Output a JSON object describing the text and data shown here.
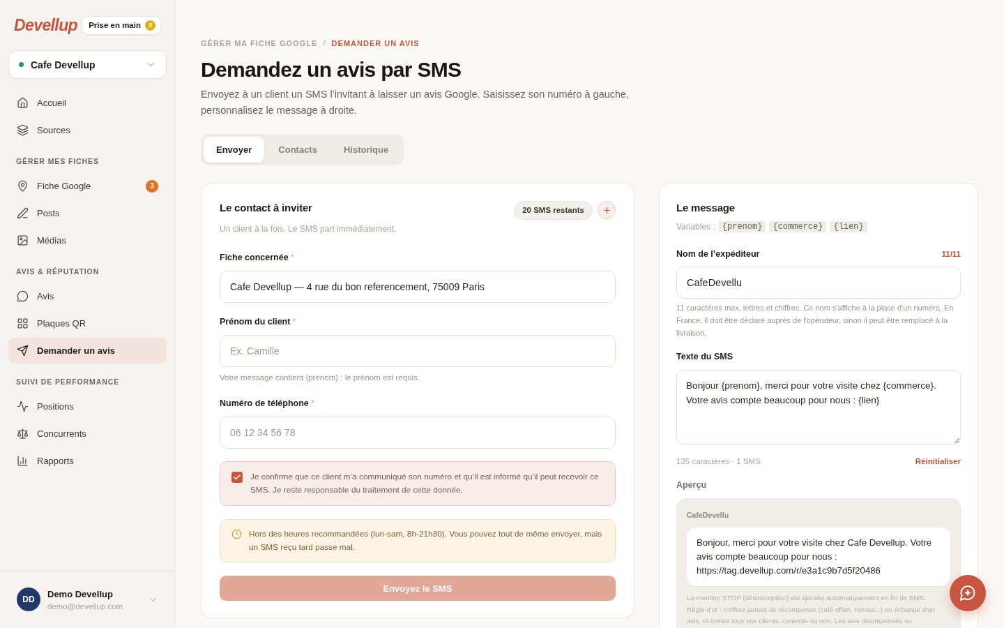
{
  "sidebar": {
    "logo": "Devellup",
    "onboarding": {
      "label": "Prise en main",
      "badge": "3"
    },
    "business": {
      "name": "Cafe Devellup"
    },
    "nav_groups": [
      {
        "items": [
          {
            "label": "Accueil",
            "selected": false
          },
          {
            "label": "Sources",
            "selected": false
          }
        ]
      },
      {
        "heading": "GÉRER MES FICHES",
        "items": [
          {
            "label": "Fiche Google",
            "selected": false,
            "badge": "3"
          },
          {
            "label": "Posts",
            "selected": false
          },
          {
            "label": "Médias",
            "selected": false
          }
        ]
      },
      {
        "heading": "AVIS & RÉPUTATION",
        "items": [
          {
            "label": "Avis",
            "selected": false
          },
          {
            "label": "Plaques QR",
            "selected": false
          },
          {
            "label": "Demander un avis",
            "selected": true
          }
        ]
      },
      {
        "heading": "SUIVI DE PERFORMANCE",
        "items": [
          {
            "label": "Positions",
            "selected": false
          },
          {
            "label": "Concurrents",
            "selected": false
          },
          {
            "label": "Rapports",
            "selected": false
          }
        ]
      }
    ],
    "user": {
      "initials": "DD",
      "name": "Demo Devellup",
      "email": "demo@devellup.com"
    }
  },
  "breadcrumb": {
    "separator": "/",
    "items": [
      {
        "label": "GÉRER MA FICHE GOOGLE",
        "selected": false
      },
      {
        "label": "DEMANDER UN AVIS",
        "selected": true
      }
    ]
  },
  "page": {
    "title": "Demandez un avis par SMS",
    "subtitle": "Envoyez à un client un SMS l’invitant à laisser un avis Google. Saisissez son numéro à gauche, personnalisez le message à droite."
  },
  "tabs": [
    {
      "label": "Envoyer",
      "selected": true
    },
    {
      "label": "Contacts",
      "selected": false
    },
    {
      "label": "Historique",
      "selected": false
    }
  ],
  "contact_card": {
    "title": "Le contact à inviter",
    "credits": "20 SMS restants",
    "subtitle": "Un client à la fois. Le SMS part immédiatement.",
    "fields": [
      {
        "label": "Fiche concernée",
        "required_mark": "*",
        "value": "Cafe Devellup — 4 rue du bon referencement, 75009 Paris"
      },
      {
        "label": "Prénom du client",
        "required_mark": "*",
        "placeholder": "Ex. Camille",
        "hint": "Votre message contient {prenom} : le prénom est requis."
      },
      {
        "label": "Numéro de téléphone",
        "required_mark": "*",
        "placeholder": "06 12 34 56 78"
      }
    ],
    "consent": {
      "checked": true,
      "text": "Je confirme que ce client m’a communiqué son numéro et qu’il est informé qu’il peut recevoir ce SMS. Je reste responsable du traitement de cette donnée."
    },
    "warning": "Hors des heures recommandées (lun-sam, 8h-21h30). Vous pouvez tout de même envoyer, mais un SMS reçu tard passe mal.",
    "send_button": {
      "label": "Envoyez le SMS",
      "disabled": true
    }
  },
  "message_card": {
    "title": "Le message",
    "variables_label": "Variables :",
    "variables": [
      "{prenom}",
      "{commerce}",
      "{lien}"
    ],
    "sender": {
      "label": "Nom de l’expéditeur",
      "counter": "11/11",
      "value": "CafeDevellu",
      "hint": "11 caractères max, lettres et chiffres. Ce nom s'affiche à la place d'un numéro. En France, il doit être déclaré auprès de l'opérateur, sinon il peut être remplacé à la livraison."
    },
    "sms": {
      "label": "Texte du SMS",
      "value": "Bonjour {prenom}, merci pour votre visite chez {commerce}. Votre avis compte beaucoup pour nous : {lien}",
      "count": "135 caractères · 1 SMS",
      "reset": "Réinitialiser"
    },
    "preview": {
      "label": "Aperçu",
      "sender": "CafeDevellu",
      "message": "Bonjour, merci pour votre visite chez Cafe Devellup. Votre avis compte beaucoup pour nous : https://tag.devellup.com/r/e3a1c9b7d5f20486",
      "notes": [
        "La mention STOP (désinscription) est ajoutée automatiquement en fin de SMS.",
        "Règle d'or : n'offrez jamais de récompense (café offert, remise...) en échange d'un avis, et invitez tous vos clients, contents ou non. Les avis récompensés ou"
      ]
    }
  }
}
